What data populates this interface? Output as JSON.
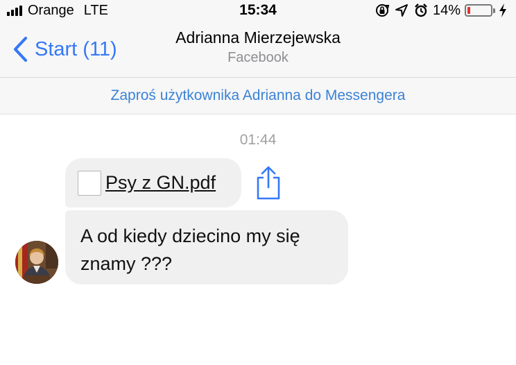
{
  "status_bar": {
    "carrier": "Orange",
    "network": "LTE",
    "time": "15:34",
    "battery_percent": "14%",
    "battery_level": 0.14,
    "icons": [
      "signal-icon",
      "rotation-lock-icon",
      "location-icon",
      "alarm-icon",
      "battery-icon",
      "charging-icon"
    ]
  },
  "nav": {
    "back_label": "Start (11)",
    "title": "Adrianna Mierzejewska",
    "subtitle": "Facebook"
  },
  "banner": {
    "invite_text": "Zaproś użytkownika Adrianna do Messengera"
  },
  "chat": {
    "timestamp": "01:44",
    "messages": [
      {
        "type": "file",
        "file_name": "Psy z GN.pdf"
      },
      {
        "type": "text",
        "text": "A od kiedy dziecino my się znamy ???"
      }
    ]
  },
  "colors": {
    "accent": "#3478f6",
    "link": "#3a82d6",
    "bubble": "#f1f0f0",
    "bar_background": "#f7f7f7",
    "battery_low": "#e5342c"
  }
}
